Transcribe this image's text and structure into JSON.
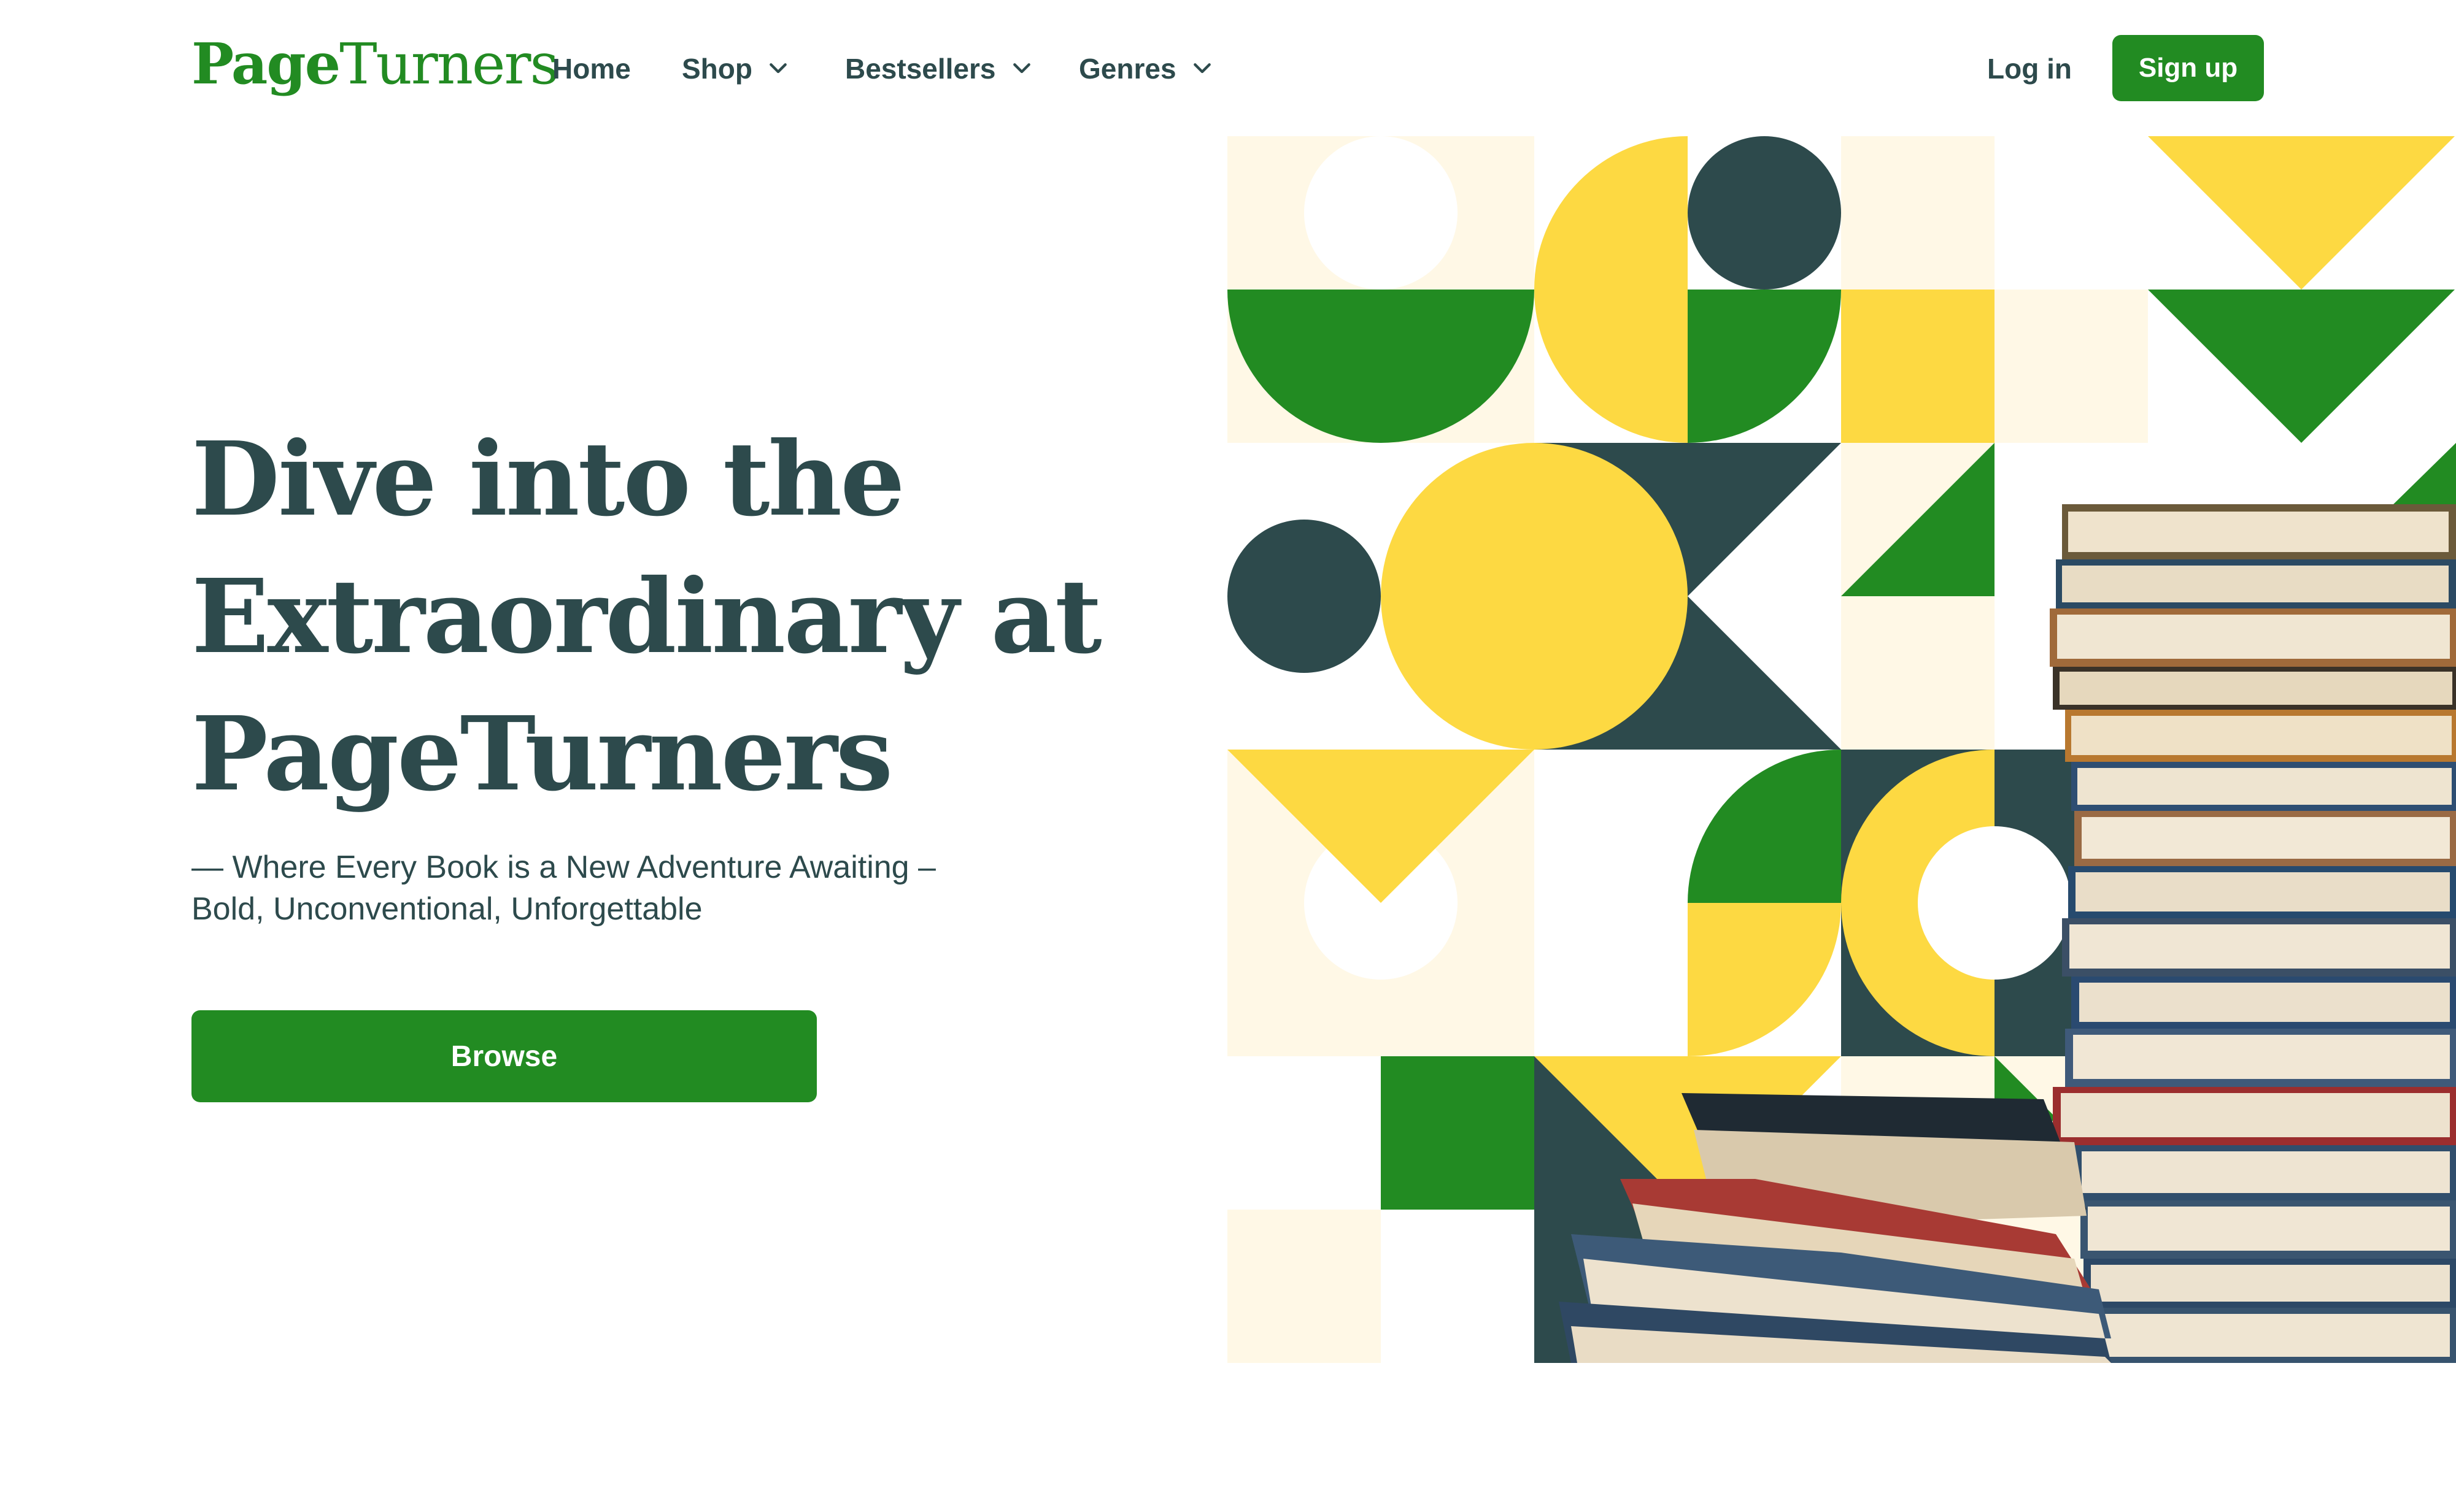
{
  "brand": {
    "logo_part1": "Page",
    "logo_part2": "Turners"
  },
  "nav": {
    "items": [
      {
        "label": "Home",
        "has_dropdown": false
      },
      {
        "label": "Shop",
        "has_dropdown": true
      },
      {
        "label": "Bestsellers",
        "has_dropdown": true
      },
      {
        "label": "Genres",
        "has_dropdown": true
      }
    ],
    "login_label": "Log in",
    "signup_label": "Sign up"
  },
  "hero": {
    "headline_line1": "Dive into the",
    "headline_line2": "Extraordinary at",
    "headline_line3": "PageTurners",
    "subtitle_line1": "— Where Every Book is a New Adventure Awaiting –",
    "subtitle_line2": "Bold, Unconventional, Unforgettable",
    "cta_label": "Browse"
  },
  "colors": {
    "primary_green": "#228b22",
    "dark_teal": "#2d4a4c",
    "yellow": "#fdd942",
    "cream": "#fff8e6",
    "white": "#ffffff"
  },
  "icons": {
    "dropdown": "chevron-down-icon"
  }
}
